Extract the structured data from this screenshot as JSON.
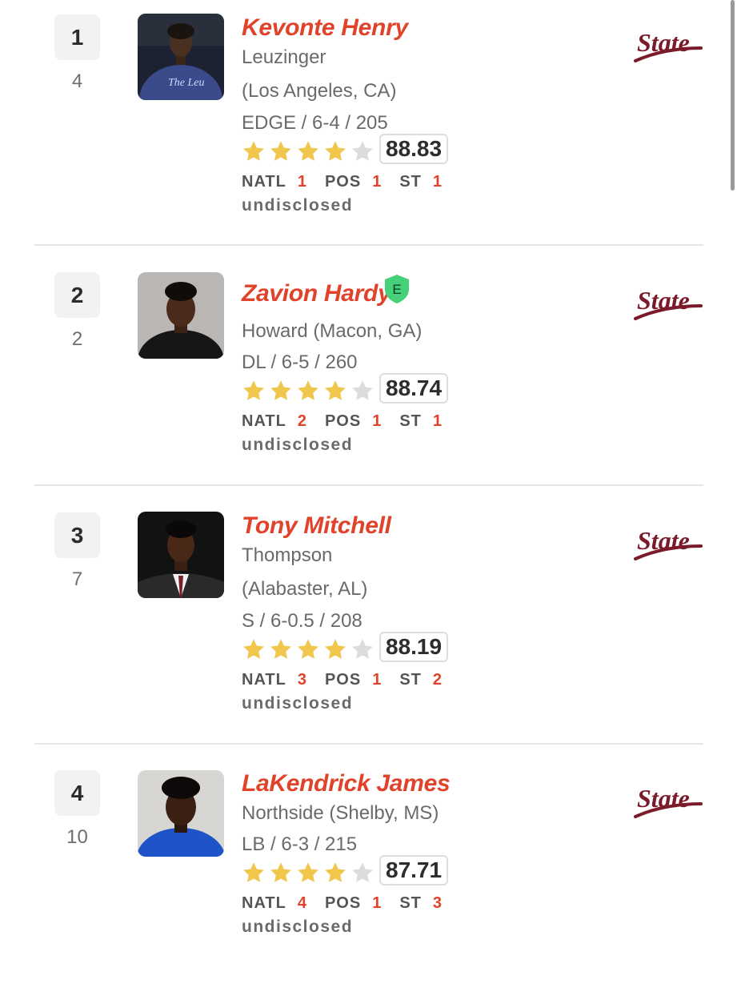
{
  "colors": {
    "name": "#e0432a",
    "star_filled": "#f0c64d",
    "star_empty": "#dcdcdc",
    "badge": "#46d07a",
    "logo": "#7a1a2a"
  },
  "logo_text": "State",
  "labels": {
    "natl": "NATL",
    "pos": "POS",
    "st": "ST"
  },
  "players": [
    {
      "rank": "1",
      "prev_rank": "4",
      "name": "Kevonte Henry",
      "line1": "Leuzinger",
      "line2": "(Los Angeles, CA)",
      "position_line": "EDGE / 6-4 / 205",
      "stars": 4,
      "score": "88.83",
      "natl": "1",
      "pos": "1",
      "st": "1",
      "status": "undisclosed",
      "badge": ""
    },
    {
      "rank": "2",
      "prev_rank": "2",
      "name": "Zavion Hardy",
      "line1": "Howard (Macon, GA)",
      "line2": "",
      "position_line": "DL / 6-5 / 260",
      "stars": 4,
      "score": "88.74",
      "natl": "2",
      "pos": "1",
      "st": "1",
      "status": "undisclosed",
      "badge": "E"
    },
    {
      "rank": "3",
      "prev_rank": "7",
      "name": "Tony Mitchell",
      "line1": "Thompson",
      "line2": "(Alabaster, AL)",
      "position_line": "S / 6-0.5 / 208",
      "stars": 4,
      "score": "88.19",
      "natl": "3",
      "pos": "1",
      "st": "2",
      "status": "undisclosed",
      "badge": ""
    },
    {
      "rank": "4",
      "prev_rank": "10",
      "name": "LaKendrick James",
      "line1": "Northside (Shelby, MS)",
      "line2": "",
      "position_line": "LB / 6-3 / 215",
      "stars": 4,
      "score": "87.71",
      "natl": "4",
      "pos": "1",
      "st": "3",
      "status": "undisclosed",
      "badge": ""
    }
  ]
}
